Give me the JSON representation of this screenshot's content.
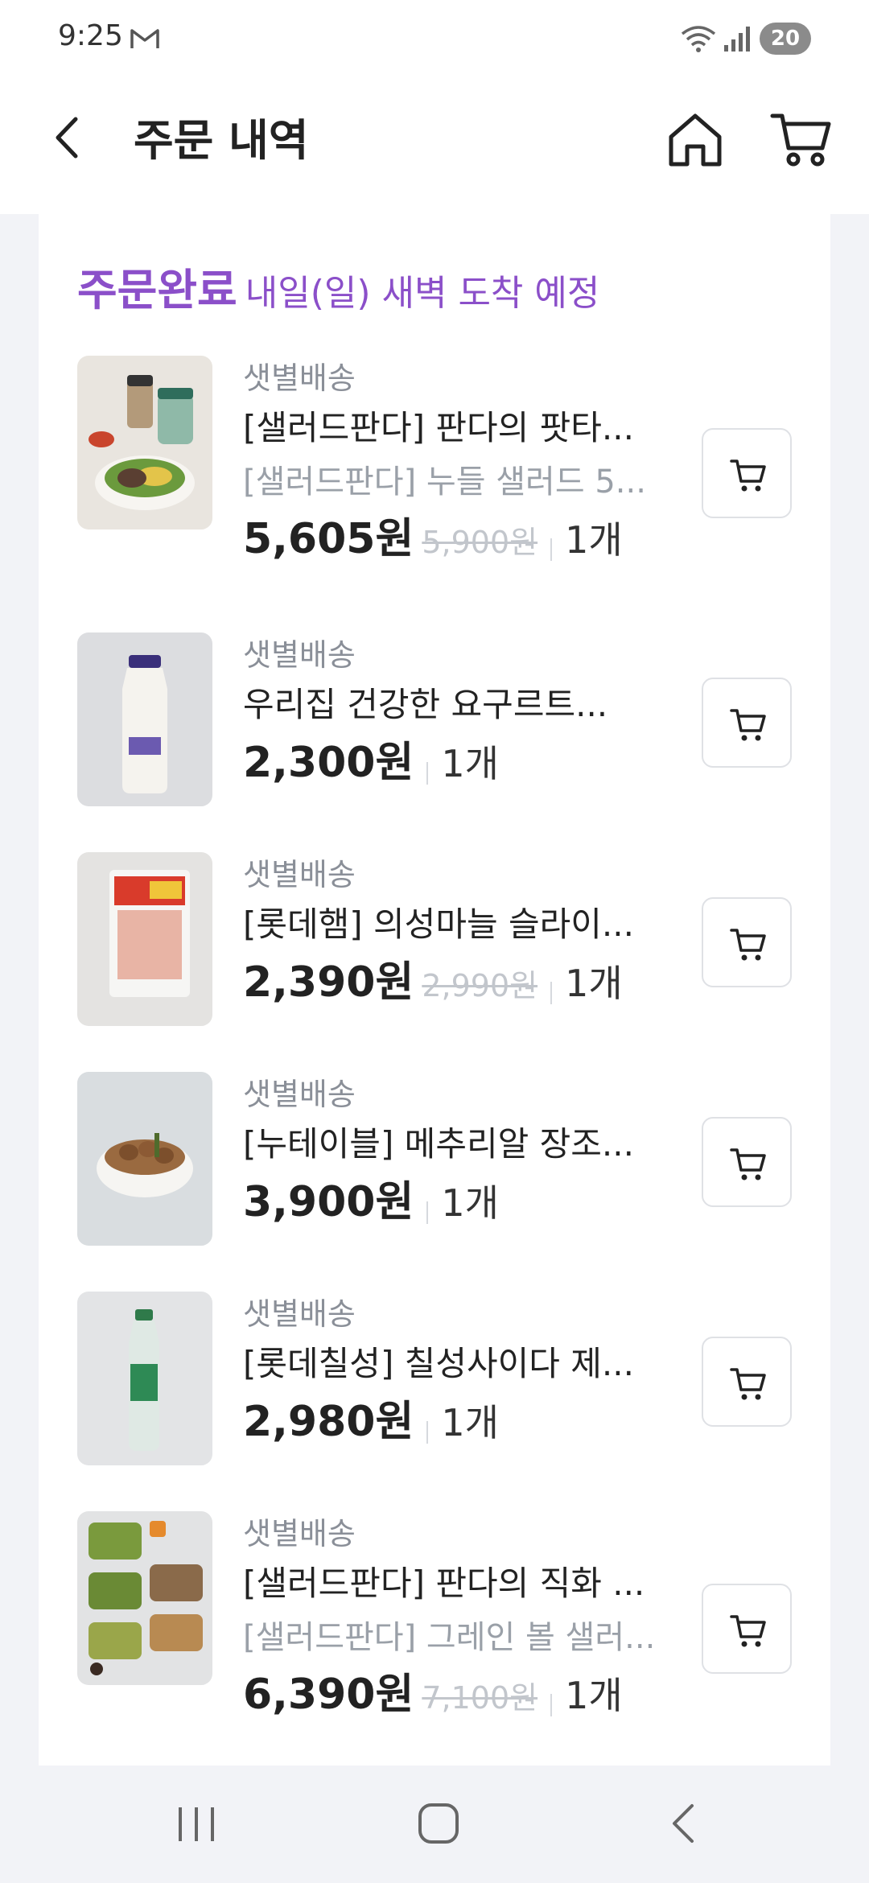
{
  "status_bar": {
    "time": "9:25",
    "battery": "20"
  },
  "header": {
    "title": "주문 내역"
  },
  "order": {
    "status": "주문완료",
    "eta": "내일(일) 새벽 도착 예정"
  },
  "items": [
    {
      "delivery": "샛별배송",
      "name": "[샐러드판다] 판다의 팟타...",
      "sub_name": "[샐러드판다] 누들 샐러드 5...",
      "price": "5,605원",
      "original_price": "5,900원",
      "quantity": "1개"
    },
    {
      "delivery": "샛별배송",
      "name": "우리집 건강한 요구르트...",
      "price": "2,300원",
      "quantity": "1개"
    },
    {
      "delivery": "샛별배송",
      "name": "[롯데햄] 의성마늘 슬라이...",
      "price": "2,390원",
      "original_price": "2,990원",
      "quantity": "1개"
    },
    {
      "delivery": "샛별배송",
      "name": "[누테이블] 메추리알 장조...",
      "price": "3,900원",
      "quantity": "1개"
    },
    {
      "delivery": "샛별배송",
      "name": "[롯데칠성] 칠성사이다 제...",
      "price": "2,980원",
      "quantity": "1개"
    },
    {
      "delivery": "샛별배송",
      "name": "[샐러드판다] 판다의 직화 ...",
      "sub_name": "[샐러드판다] 그레인 볼 샐러...",
      "price": "6,390원",
      "original_price": "7,100원",
      "quantity": "1개"
    }
  ],
  "colors": {
    "accent": "#8b4fc9",
    "background": "#f2f3f7"
  },
  "icons": {
    "back": "back-arrow-icon",
    "home": "home-icon",
    "cart": "cart-icon",
    "add_to_cart": "cart-icon"
  }
}
